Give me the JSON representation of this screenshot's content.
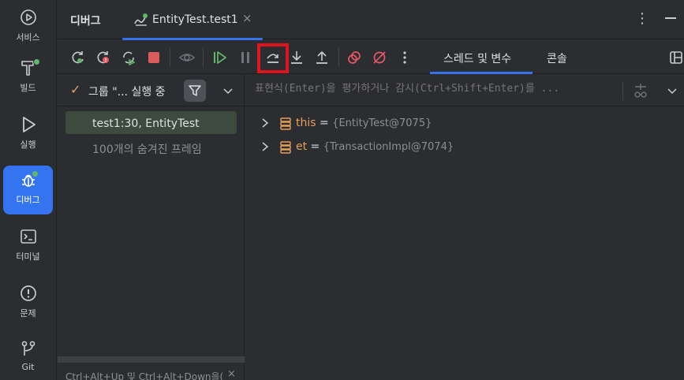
{
  "sidebar": {
    "items": [
      {
        "label": "서비스",
        "icon": "services-icon"
      },
      {
        "label": "빌드",
        "icon": "build-hammer-icon"
      },
      {
        "label": "실행",
        "icon": "run-icon"
      },
      {
        "label": "디버그",
        "icon": "debug-bug-icon",
        "active": true
      },
      {
        "label": "터미널",
        "icon": "terminal-icon"
      },
      {
        "label": "문제",
        "icon": "problems-icon"
      },
      {
        "label": "Git",
        "icon": "git-icon"
      }
    ]
  },
  "header": {
    "title": "디버그",
    "tab_label": "EntityTest.test1",
    "tab_close": "×",
    "more": "⋮"
  },
  "toolbar": {
    "buttons": [
      "rerun-icon",
      "rerun-failed-icon",
      "restart-icon",
      "stop-icon",
      "view-breakpoints-icon",
      "resume-icon",
      "pause-icon",
      "step-over-icon",
      "step-into-icon",
      "step-out-icon",
      "mute-breakpoints-icon",
      "clear-breakpoints-icon",
      "more-icon"
    ],
    "tabs": [
      "스레드 및 변수",
      "콘솔"
    ],
    "more": "⋮"
  },
  "frames": {
    "group_label": "그룹 \"... 실행 중",
    "check": "✓",
    "rows": [
      {
        "text": "test1:30, EntityTest",
        "selected": true
      },
      {
        "text": "100개의 숨겨진 프레임",
        "selected": false
      }
    ],
    "hint": "Ctrl+Alt+Up 및 Ctrl+Alt+Down을(",
    "hint_close": "×"
  },
  "variables": {
    "eval_placeholder": "표현식(Enter)을 평가하거나 감시(Ctrl+Shift+Enter)를 ...",
    "rows": [
      {
        "name": "this",
        "eq": " = ",
        "value": "{EntityTest@7075}"
      },
      {
        "name": "et",
        "eq": " = ",
        "value": "{TransactionImpl@7074}"
      }
    ]
  },
  "colors": {
    "accent": "#3574f0",
    "highlight": "#e0141e",
    "var_name": "#e6a05a",
    "run_green": "#5fb865"
  }
}
